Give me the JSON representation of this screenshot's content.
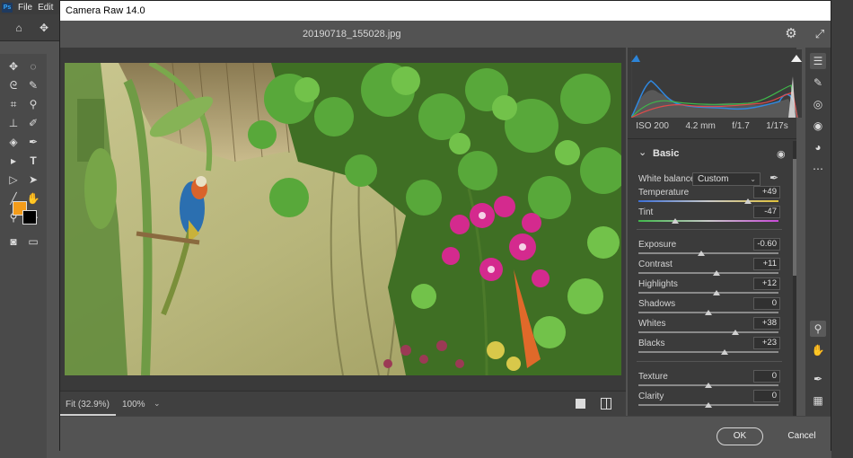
{
  "ps": {
    "menu": [
      "File",
      "Edit"
    ],
    "logo": "Ps"
  },
  "dialog": {
    "title": "Camera Raw 14.0",
    "file_name": "20190718_155028.jpg"
  },
  "histogram": {
    "iso": "ISO 200",
    "focal": "4.2 mm",
    "aperture": "f/1.7",
    "shutter": "1/17s"
  },
  "basic": {
    "title": "Basic",
    "white_balance_label": "White balance",
    "white_balance_value": "Custom",
    "sliders": [
      {
        "label": "Temperature",
        "value": "+49",
        "level": 0.78
      },
      {
        "label": "Tint",
        "value": "-47",
        "level": 0.26
      },
      {
        "label": "Exposure",
        "value": "-0.60",
        "level": 0.45
      },
      {
        "label": "Contrast",
        "value": "+11",
        "level": 0.555
      },
      {
        "label": "Highlights",
        "value": "+12",
        "level": 0.56
      },
      {
        "label": "Shadows",
        "value": "0",
        "level": 0.5
      },
      {
        "label": "Whites",
        "value": "+38",
        "level": 0.69
      },
      {
        "label": "Blacks",
        "value": "+23",
        "level": 0.615
      },
      {
        "label": "Texture",
        "value": "0",
        "level": 0.5
      },
      {
        "label": "Clarity",
        "value": "0",
        "level": 0.5
      }
    ]
  },
  "view": {
    "zoom_fit": "Fit (32.9%)",
    "zoom_100": "100%"
  },
  "footer": {
    "ok": "OK",
    "cancel": "Cancel"
  }
}
